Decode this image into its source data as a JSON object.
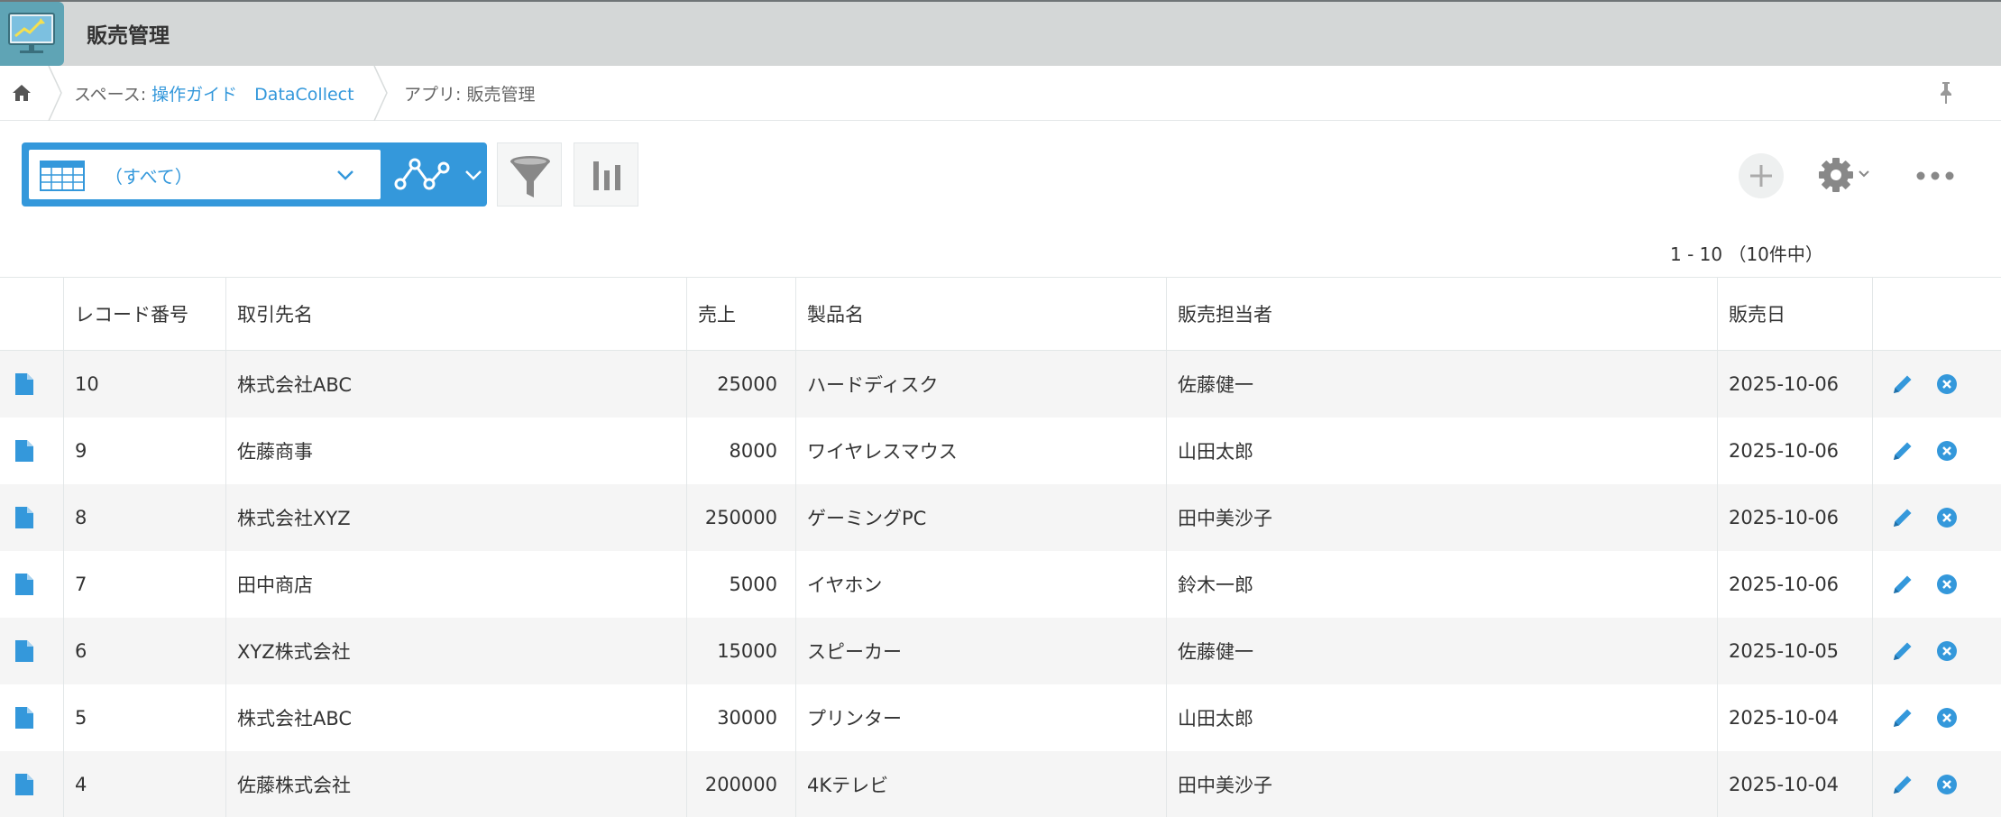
{
  "app": {
    "title": "販売管理"
  },
  "breadcrumb": {
    "space_prefix": "スペース: ",
    "space_name": "操作ガイド　DataCollect",
    "app_label": "アプリ: 販売管理"
  },
  "toolbar": {
    "view_label": "（すべて）",
    "icons": [
      "table-icon",
      "graph-icon",
      "filter-icon",
      "stats-icon",
      "add-icon",
      "gear-icon",
      "more-icon",
      "pin-icon",
      "home-icon"
    ]
  },
  "pager": {
    "text": "1 - 10 （10件中）"
  },
  "table": {
    "headers": {
      "no": "レコード番号",
      "customer": "取引先名",
      "sales": "売上",
      "product": "製品名",
      "rep": "販売担当者",
      "date": "販売日"
    },
    "rows": [
      {
        "no": "10",
        "customer": "株式会社ABC",
        "sales": "25000",
        "product": "ハードディスク",
        "rep": "佐藤健一",
        "date": "2025-10-06"
      },
      {
        "no": "9",
        "customer": "佐藤商事",
        "sales": "8000",
        "product": "ワイヤレスマウス",
        "rep": "山田太郎",
        "date": "2025-10-06"
      },
      {
        "no": "8",
        "customer": "株式会社XYZ",
        "sales": "250000",
        "product": "ゲーミングPC",
        "rep": "田中美沙子",
        "date": "2025-10-06"
      },
      {
        "no": "7",
        "customer": "田中商店",
        "sales": "5000",
        "product": "イヤホン",
        "rep": "鈴木一郎",
        "date": "2025-10-06"
      },
      {
        "no": "6",
        "customer": "XYZ株式会社",
        "sales": "15000",
        "product": "スピーカー",
        "rep": "佐藤健一",
        "date": "2025-10-05"
      },
      {
        "no": "5",
        "customer": "株式会社ABC",
        "sales": "30000",
        "product": "プリンター",
        "rep": "山田太郎",
        "date": "2025-10-04"
      },
      {
        "no": "4",
        "customer": "佐藤株式会社",
        "sales": "200000",
        "product": "4Kテレビ",
        "rep": "田中美沙子",
        "date": "2025-10-04"
      }
    ]
  },
  "colors": {
    "accent": "#3498db",
    "header_bg": "#d4d7d7",
    "row_stripe": "#f5f5f5",
    "delete": "#3498db"
  }
}
